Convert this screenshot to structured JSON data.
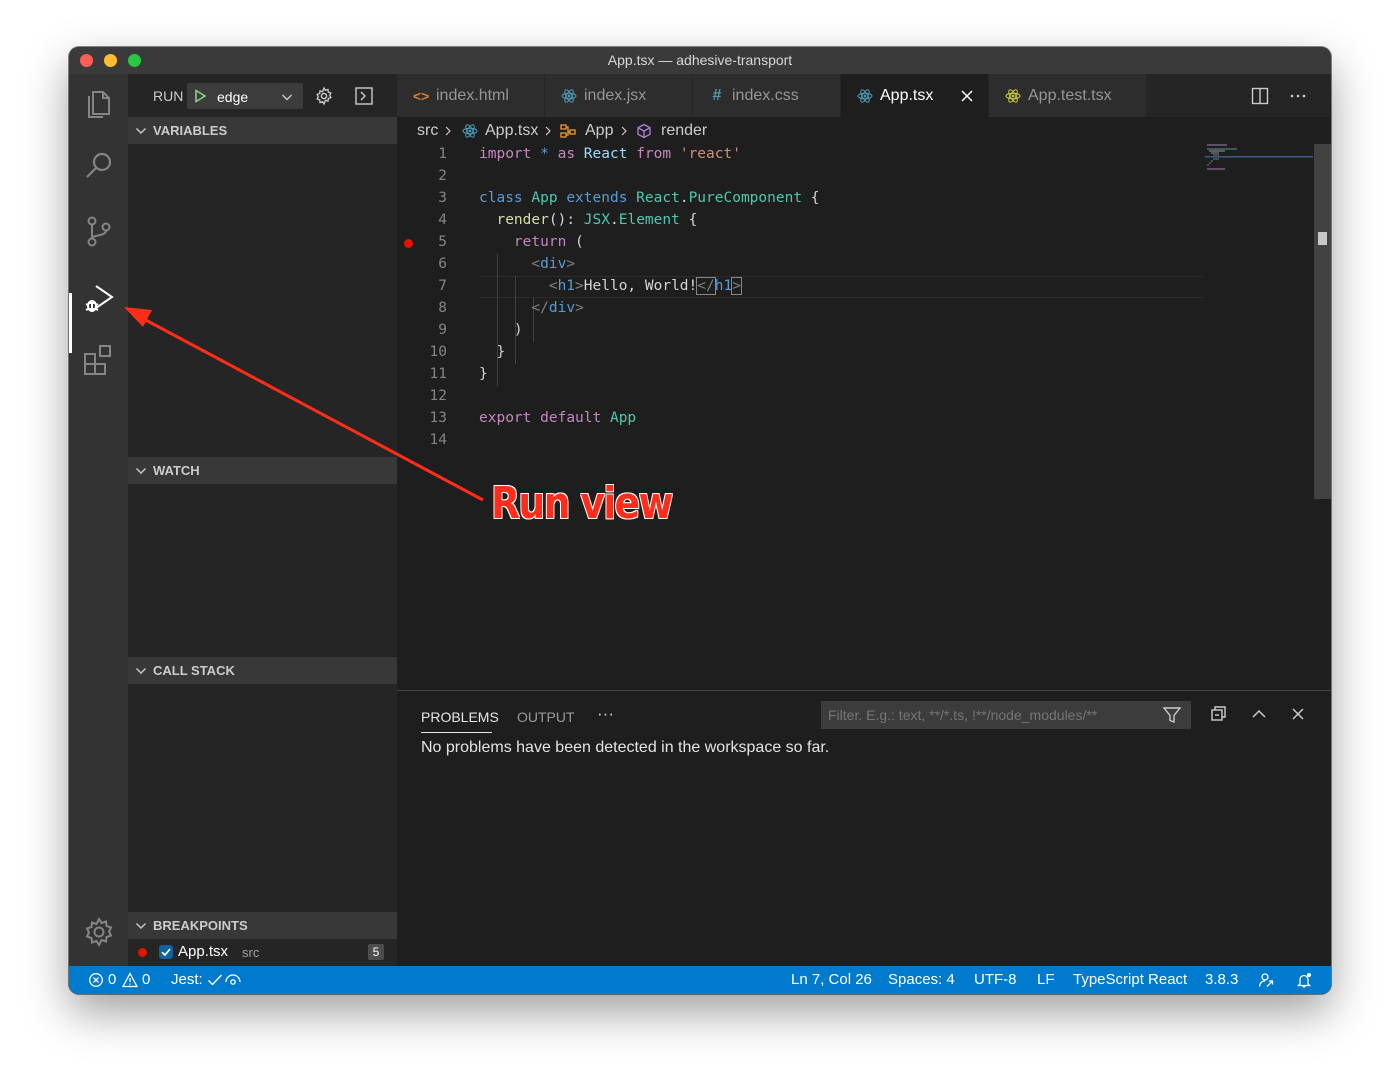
{
  "window": {
    "title": "App.tsx — adhesive-transport"
  },
  "activity_bar": {
    "items": [
      "explorer-icon",
      "search-icon",
      "source-control-icon",
      "run-debug-icon",
      "extensions-icon"
    ],
    "active": "run-debug-icon",
    "bottom": "settings-gear-icon"
  },
  "run": {
    "label": "RUN",
    "config": "edge"
  },
  "sections": {
    "variables": "VARIABLES",
    "watch": "WATCH",
    "call_stack": "CALL STACK",
    "breakpoints": "BREAKPOINTS"
  },
  "breakpoint_item": {
    "file": "App.tsx",
    "dir": "src",
    "count": "5"
  },
  "tabs": [
    {
      "label": "index.html",
      "icon": "<>",
      "color": "#e37933"
    },
    {
      "label": "index.jsx",
      "icon": "react",
      "color": "#519aba"
    },
    {
      "label": "index.css",
      "icon": "#",
      "color": "#519aba"
    },
    {
      "label": "App.tsx",
      "icon": "react",
      "color": "#519aba",
      "active": true
    },
    {
      "label": "App.test.tsx",
      "icon": "react",
      "color": "#cbcb41"
    }
  ],
  "breadcrumb": {
    "src": "src",
    "file": "App.tsx",
    "class": "App",
    "method": "render"
  },
  "editor": {
    "line_numbers": [
      "1",
      "2",
      "3",
      "4",
      "5",
      "6",
      "7",
      "8",
      "9",
      "10",
      "11",
      "12",
      "13",
      "14"
    ],
    "cursor_line": 7,
    "breakpoint_line": 5
  },
  "code": {
    "l1": [
      "import",
      "*",
      "as",
      "React",
      "from",
      "'react'"
    ],
    "l3": [
      "class",
      "App",
      "extends",
      "React",
      ".",
      "PureComponent",
      "{"
    ],
    "l4": [
      "render",
      "():",
      "JSX",
      ".",
      "Element",
      "{"
    ],
    "l5": [
      "return",
      "("
    ],
    "l6": [
      "<",
      "div",
      ">"
    ],
    "l7": [
      "<",
      "h1",
      ">",
      "Hello, World!",
      "</",
      "h1",
      ">"
    ],
    "l8": [
      "</",
      "div",
      ">"
    ],
    "l9": ")",
    "l10": "}",
    "l11": "}",
    "l13": [
      "export",
      "default",
      "App"
    ]
  },
  "panel": {
    "tabs": [
      "PROBLEMS",
      "OUTPUT"
    ],
    "more": "···",
    "filter_placeholder": "Filter. E.g.: text, **/*.ts, !**/node_modules/**",
    "message": "No problems have been detected in the workspace so far."
  },
  "status_bar": {
    "errors": "0",
    "warnings": "0",
    "jest": "Jest:",
    "position": "Ln 7, Col 26",
    "spaces": "Spaces: 4",
    "encoding": "UTF-8",
    "eol": "LF",
    "language": "TypeScript React",
    "ts_version": "3.8.3"
  },
  "annotation": {
    "text": "Run view",
    "color": "#ff2d1a"
  }
}
